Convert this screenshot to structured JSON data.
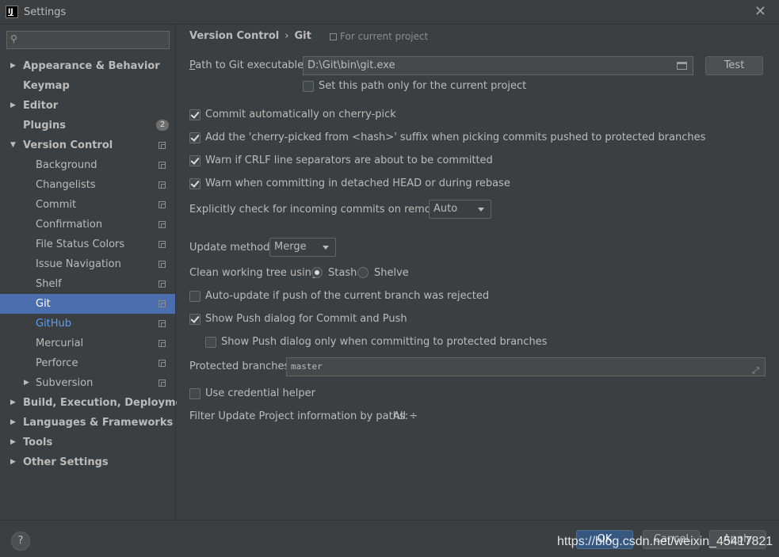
{
  "window": {
    "app_icon": "IJ",
    "title": "Settings",
    "close_glyph": "✕"
  },
  "sidebar": {
    "search_placeholder": "",
    "items": [
      {
        "label": "Appearance & Behavior",
        "level": 0,
        "bold": true,
        "arrow": "▶"
      },
      {
        "label": "Keymap",
        "level": 0,
        "bold": true
      },
      {
        "label": "Editor",
        "level": 0,
        "bold": true,
        "arrow": "▶"
      },
      {
        "label": "Plugins",
        "level": 0,
        "bold": true,
        "badge": "2"
      },
      {
        "label": "Version Control",
        "level": 0,
        "bold": true,
        "arrow": "▼",
        "project_icon": true
      },
      {
        "label": "Background",
        "level": 1,
        "project_icon": true
      },
      {
        "label": "Changelists",
        "level": 1,
        "project_icon": true
      },
      {
        "label": "Commit",
        "level": 1,
        "project_icon": true
      },
      {
        "label": "Confirmation",
        "level": 1,
        "project_icon": true
      },
      {
        "label": "File Status Colors",
        "level": 1,
        "project_icon": true
      },
      {
        "label": "Issue Navigation",
        "level": 1,
        "project_icon": true
      },
      {
        "label": "Shelf",
        "level": 1,
        "project_icon": true
      },
      {
        "label": "Git",
        "level": 1,
        "project_icon": true,
        "selected": true
      },
      {
        "label": "GitHub",
        "level": 1,
        "project_icon": true,
        "link": true
      },
      {
        "label": "Mercurial",
        "level": 1,
        "project_icon": true
      },
      {
        "label": "Perforce",
        "level": 1,
        "project_icon": true
      },
      {
        "label": "Subversion",
        "level": 1,
        "project_icon": true,
        "arrow": "▶"
      },
      {
        "label": "Build, Execution, Deployment",
        "level": 0,
        "bold": true,
        "arrow": "▶"
      },
      {
        "label": "Languages & Frameworks",
        "level": 0,
        "bold": true,
        "arrow": "▶"
      },
      {
        "label": "Tools",
        "level": 0,
        "bold": true,
        "arrow": "▶"
      },
      {
        "label": "Other Settings",
        "level": 0,
        "bold": true,
        "arrow": "▶"
      }
    ]
  },
  "content": {
    "breadcrumb": {
      "parent": "Version Control",
      "sep": "›",
      "current": "Git"
    },
    "for_current_project": "For current project",
    "git_path": {
      "label_first": "P",
      "label_rest": "ath to Git executable:",
      "value": "D:\\Git\\bin\\git.exe",
      "test_button": "Test"
    },
    "set_path_only_label": "Set this path only for the current project",
    "options": {
      "commit_cherry_pick": "Commit automatically on cherry-pick",
      "cherry_picked_suffix": "Add the 'cherry-picked from <hash>' suffix when picking commits pushed to protected branches",
      "warn_crlf": "Warn if CRLF line separators are about to be committed",
      "warn_detached": "Warn when committing in detached HEAD or during rebase"
    },
    "incoming_commits": {
      "label": "Explicitly check for incoming commits on remotes:",
      "value": "Auto"
    },
    "update_method": {
      "label": "Update method:",
      "value": "Merge"
    },
    "clean_tree": {
      "label": "Clean working tree using:",
      "stash": "Stash",
      "shelve": "Shelve"
    },
    "auto_update_label": "Auto-update if push of the current branch was rejected",
    "show_push_label": "Show Push dialog for Commit and Push",
    "show_push_protected_label": "Show Push dialog only when committing to protected branches",
    "protected_branches": {
      "label": "Protected branches:",
      "value": "master"
    },
    "credential_helper_label": "Use credential helper",
    "filter_update": {
      "label": "Filter Update Project information by paths:",
      "value": "All",
      "arrow": "÷"
    }
  },
  "footer": {
    "help": "?",
    "ok": "OK",
    "cancel": "Cancel",
    "apply": "Apply",
    "watermark": "https://blog.csdn.net/weixin_45417821"
  }
}
